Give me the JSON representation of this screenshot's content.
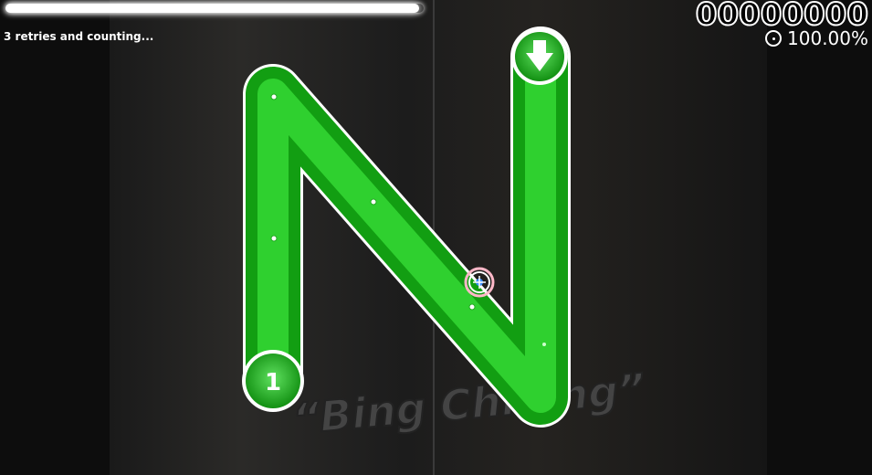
{
  "hud": {
    "retries": "3 retries and counting...",
    "score": "00000000",
    "accuracy": "100.00%",
    "song_progress": 0.99
  },
  "beatmap": {
    "caption": "“Bing Chilling”",
    "slider_color": "#1fb51f",
    "combo_number": "1",
    "reverse_arrow": "down-arrow-icon"
  },
  "icons": {
    "accuracy": "accuracy-pie-icon",
    "cursor": "cursor-icon",
    "slider_ticks": "slider-tick-icon"
  }
}
